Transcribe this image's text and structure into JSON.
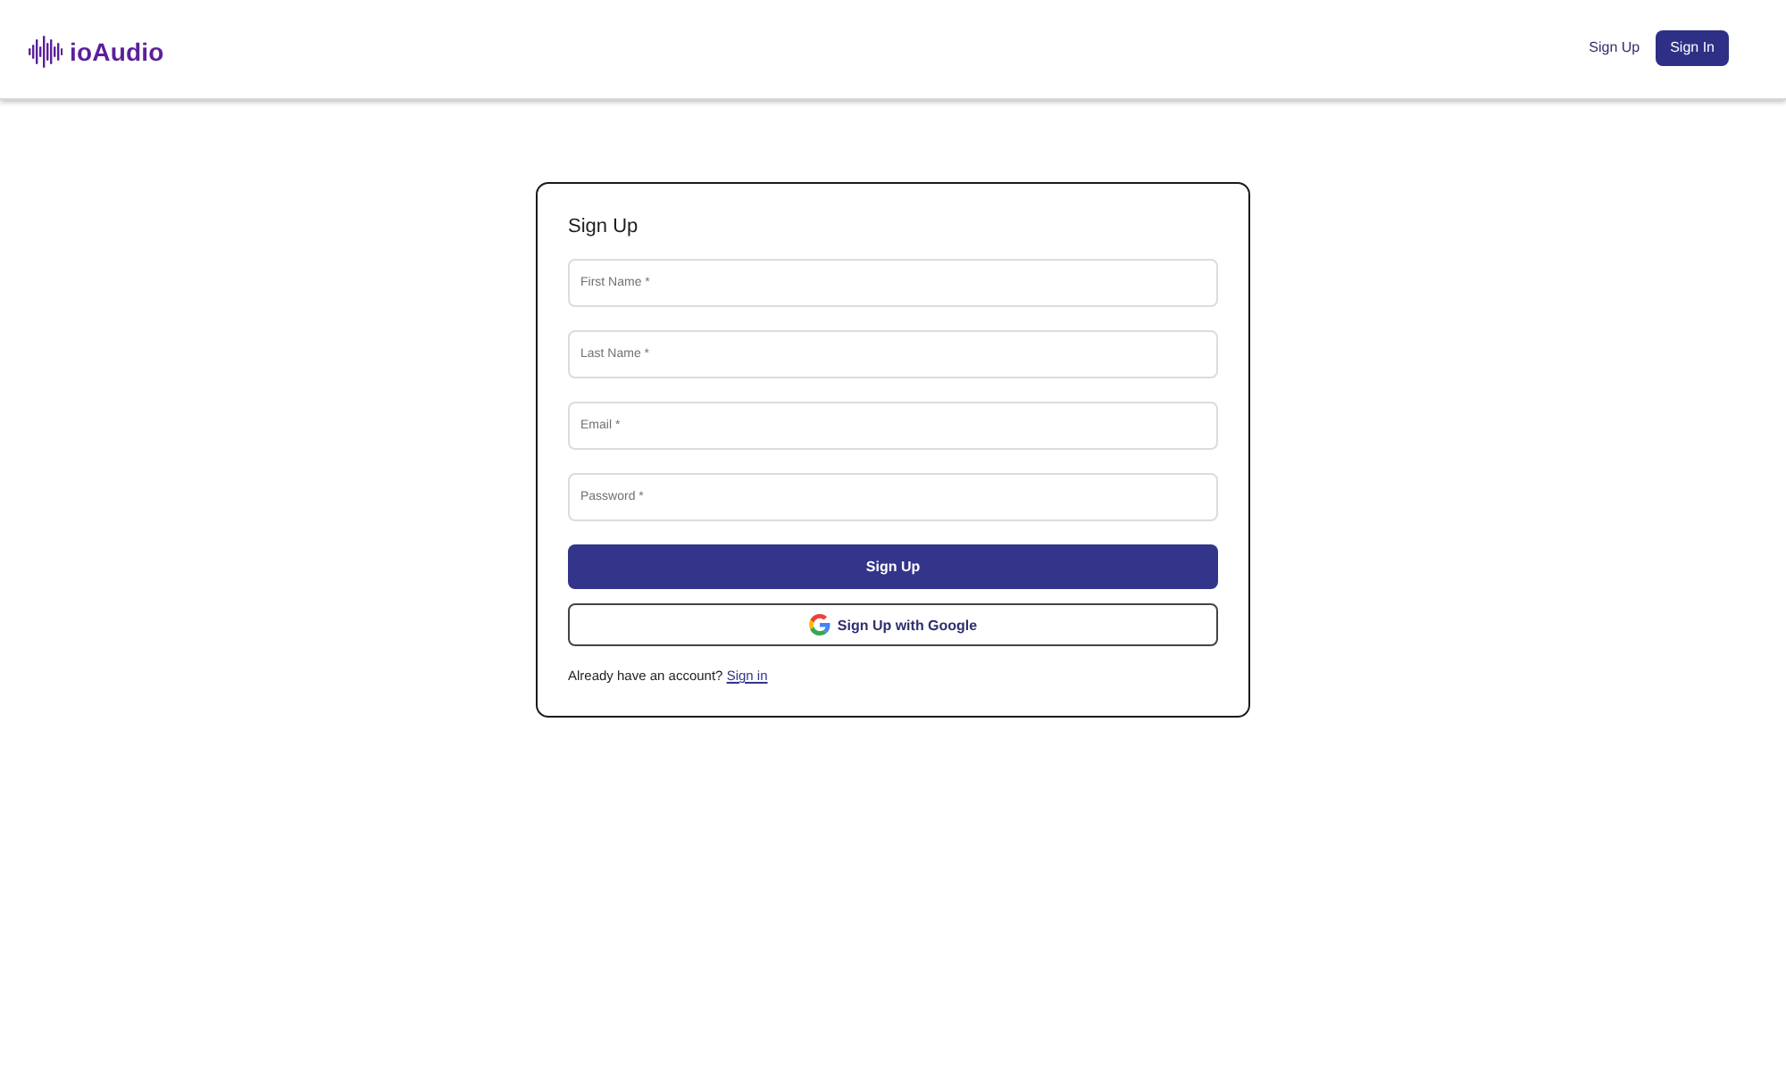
{
  "header": {
    "logo": "ioAudio",
    "nav": [
      {
        "label": "Sign Up",
        "kind": "link"
      },
      {
        "label": "Sign In",
        "kind": "button"
      }
    ]
  },
  "form": {
    "title": "Sign Up",
    "fields": [
      {
        "placeholder": "First Name *"
      },
      {
        "placeholder": "Last Name *"
      },
      {
        "placeholder": "Email *"
      },
      {
        "placeholder": "Password *"
      }
    ],
    "submit": "Sign Up",
    "google_button": "Sign Up with Google",
    "footer": {
      "text": "Already have an account?",
      "link": "Sign in"
    }
  }
}
